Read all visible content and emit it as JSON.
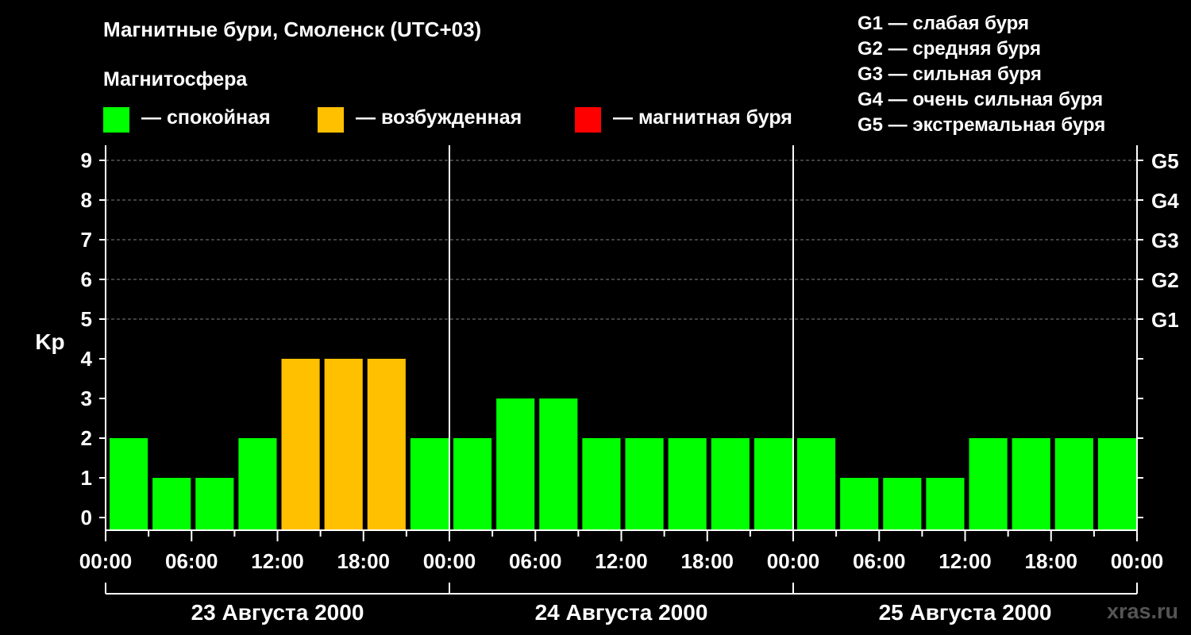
{
  "title": "Магнитные бури, Смоленск (UTC+03)",
  "subtitle": "Магнитосфера",
  "legend": [
    {
      "label": "— спокойная",
      "color": "#00FF00"
    },
    {
      "label": "— возбужденная",
      "color": "#FFC000"
    },
    {
      "label": "— магнитная буря",
      "color": "#FF0000"
    }
  ],
  "g_scale": [
    "G1 — слабая буря",
    "G2 — средняя буря",
    "G3 — сильная буря",
    "G4 — очень сильная буря",
    "G5 — экстремальная буря"
  ],
  "watermark": "xras.ru",
  "colors": {
    "background": "#000000",
    "axis": "#FFFFFF",
    "grid": "#808080"
  },
  "chart_data": {
    "type": "bar",
    "ylabel": "Kp",
    "ylim": [
      0,
      9
    ],
    "yticks": [
      0,
      1,
      2,
      3,
      4,
      5,
      6,
      7,
      8,
      9
    ],
    "right_ticks": [
      {
        "value": 5,
        "label": "G1"
      },
      {
        "value": 6,
        "label": "G2"
      },
      {
        "value": 7,
        "label": "G3"
      },
      {
        "value": 8,
        "label": "G4"
      },
      {
        "value": 9,
        "label": "G5"
      }
    ],
    "grid": "dashed horizontal at Kp 5–9",
    "x_tick_labels": [
      "00:00",
      "06:00",
      "12:00",
      "18:00",
      "00:00",
      "06:00",
      "12:00",
      "18:00",
      "00:00",
      "06:00",
      "12:00",
      "18:00",
      "00:00"
    ],
    "days": [
      "23 Августа 2000",
      "24 Августа 2000",
      "25 Августа 2000"
    ],
    "interval_hours": 3,
    "values": [
      2,
      1,
      1,
      2,
      4,
      4,
      4,
      2,
      2,
      3,
      3,
      2,
      2,
      2,
      2,
      2,
      2,
      1,
      1,
      1,
      2,
      2,
      2,
      2
    ],
    "categories": [
      "quiet",
      "quiet",
      "quiet",
      "quiet",
      "active",
      "active",
      "active",
      "quiet",
      "quiet",
      "quiet",
      "quiet",
      "quiet",
      "quiet",
      "quiet",
      "quiet",
      "quiet",
      "quiet",
      "quiet",
      "quiet",
      "quiet",
      "quiet",
      "quiet",
      "quiet",
      "quiet"
    ]
  }
}
